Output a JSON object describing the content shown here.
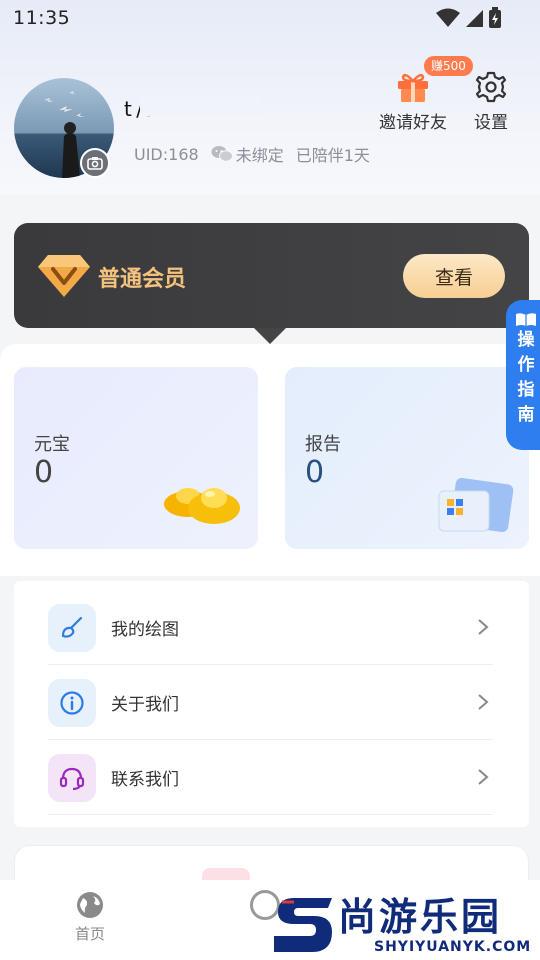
{
  "status_bar": {
    "time": "11:35"
  },
  "profile": {
    "nickname": "t           /6",
    "uid": "UID:168",
    "wechat_status": "未绑定",
    "days": "已陪伴1天"
  },
  "actions": {
    "invite_label": "邀请好友",
    "invite_badge": "赚500",
    "settings_label": "设置"
  },
  "member": {
    "label": "普通会员",
    "view_button": "查看",
    "accent": "#f3c27d"
  },
  "guide_tab": {
    "chars": [
      "操",
      "作",
      "指",
      "南"
    ]
  },
  "stats": [
    {
      "title": "元宝",
      "value": "0"
    },
    {
      "title": "报告",
      "value": "0"
    }
  ],
  "menu": [
    {
      "label": "我的绘图",
      "icon": "brush-icon"
    },
    {
      "label": "关于我们",
      "icon": "info-icon"
    },
    {
      "label": "联系我们",
      "icon": "headset-icon"
    }
  ],
  "tabbar": {
    "home_label": "首页"
  },
  "watermark": {
    "title": "尚游乐园",
    "url": "SHYIYUANYK.COM"
  }
}
